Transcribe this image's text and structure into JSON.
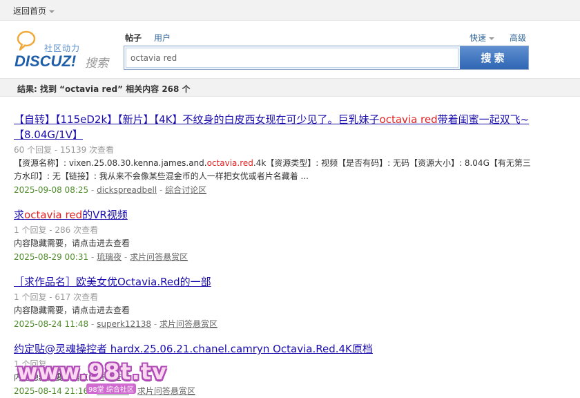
{
  "topbar": {
    "home_label": "返回首页"
  },
  "logo": {
    "tagline": "社区动力",
    "brand": "DISCUZ!",
    "search_word": "搜索"
  },
  "search": {
    "tab_posts": "帖子",
    "tab_users": "用户",
    "fast_label": "快速",
    "advanced_label": "高级",
    "query": "octavia red",
    "button_label": "搜索"
  },
  "result_summary": "结果: 找到 “octavia red” 相关内容 268 个",
  "results": [
    {
      "title_before": "【自转】【115eD2k】【新片】【4K】不纹身的白皮西女现在可少见了。巨乳妹子",
      "title_hl": "octavia red",
      "title_after": "带着闺蜜一起双飞~【8.04G/1V】",
      "meta": "60 个回复 - 15139 次查看",
      "snippet_before": "【资源名称】: vixen.25.08.30.kenna.james.and.",
      "snippet_hl": "octavia.red",
      "snippet_after": ".4k【资源类型】: 视频【是否有码】: 无码【资源大小】: 8.04G【有无第三方水印】: 无【链接】: 我从来不会像某些混金币的人一样把女优或者片名藏着 ...",
      "date": "2025-09-08 08:25",
      "author": "dickspreadbell",
      "forum": "综合讨论区"
    },
    {
      "title_before": "求",
      "title_hl": "octavia red",
      "title_after": "的VR视频",
      "meta": "1 个回复 - 286 次查看",
      "snippet_before": "内容隐藏需要，请点击进去查看",
      "snippet_hl": "",
      "snippet_after": "",
      "date": "2025-08-29 00:31",
      "author": "琉璃夜",
      "forum": "求片问答悬赏区"
    },
    {
      "title_before": "［求作品名］欧美女优Octavia.Red的一部",
      "title_hl": "",
      "title_after": "",
      "meta": "1 个回复 - 617 次查看",
      "snippet_before": "内容隐藏需要，请点击进去查看",
      "snippet_hl": "",
      "snippet_after": "",
      "date": "2025-08-24 11:48",
      "author": "superk12138",
      "forum": "求片问答悬赏区"
    },
    {
      "title_before": "约定贴@灵魂操控者 hardx.25.06.21.chanel.camryn Octavia.Red.4K原档",
      "title_hl": "",
      "title_after": "",
      "meta": "1 个回复",
      "snippet_before": "内容隐藏需要，请点击进去查看",
      "snippet_hl": "",
      "snippet_after": "",
      "date": "2025-08-14 21:16",
      "author": "CLEARV",
      "forum": "求片问答悬赏区"
    }
  ],
  "watermark": {
    "text": "www.98t.tv",
    "sub": "98堂 综合社区"
  },
  "colors": {
    "link": "#1a0dab",
    "highlight": "#e02020",
    "date": "#4f8b2a",
    "button": "#2f66b3"
  }
}
